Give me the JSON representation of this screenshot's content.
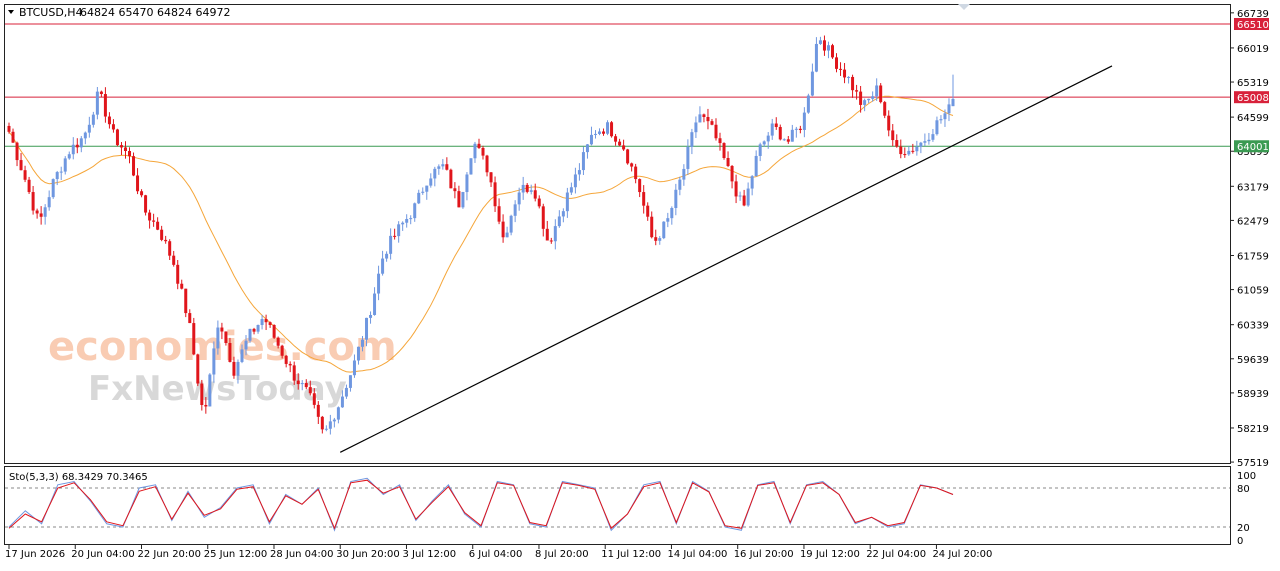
{
  "header": {
    "symbol": "BTCUSD,H4",
    "ohlc": "64824 65470 64824 64972"
  },
  "watermark": {
    "line1": "economies.com",
    "line2": "FxNewsToday"
  },
  "stochastic_label": "Sto(5,3,3) 68.3429 70.3465",
  "colors": {
    "bull": "#6f97e0",
    "bear": "#e0151b",
    "ma": "#f5a63a",
    "resistance": "#d8213a",
    "support": "#3a9a52",
    "trendline": "#000000",
    "sto_main": "#6f97e0",
    "sto_signal": "#e0151b",
    "label_red_bg": "#d8213a",
    "label_green_bg": "#3a9a52"
  },
  "chart_data": [
    {
      "type": "candlestick",
      "title": "BTCUSD,H4",
      "x_tick_labels": [
        "17 Jun 2026",
        "20 Jun 04:00",
        "22 Jun 20:00",
        "25 Jun 12:00",
        "28 Jun 04:00",
        "30 Jun 20:00",
        "3 Jul 12:00",
        "6 Jul 04:00",
        "8 Jul 20:00",
        "11 Jul 12:00",
        "14 Jul 04:00",
        "16 Jul 20:00",
        "19 Jul 12:00",
        "22 Jul 04:00",
        "24 Jul 20:00"
      ],
      "y_tick_labels": [
        66739,
        66019,
        65319,
        64599,
        63899,
        63179,
        62479,
        61759,
        61059,
        60339,
        59639,
        58939,
        58219,
        57519
      ],
      "ylim": [
        57500,
        66900
      ],
      "current_bar": {
        "open": 64824,
        "high": 65470,
        "low": 64824,
        "close": 64972
      },
      "horizontal_levels": [
        {
          "value": 66510,
          "label": "66510",
          "role": "resistance"
        },
        {
          "value": 65008,
          "label": "65008",
          "role": "resistance"
        },
        {
          "value": 64001,
          "label": "64001",
          "role": "support"
        }
      ],
      "trendline": {
        "from": {
          "x": "30 Jun 20:00",
          "y": 57720
        },
        "to": {
          "x": "27 Jul",
          "y": 65650
        }
      },
      "price_path": [
        64300,
        63400,
        62400,
        63300,
        63900,
        64200,
        65100,
        64200,
        63800,
        62700,
        62300,
        61600,
        60400,
        58400,
        60500,
        59400,
        60100,
        60500,
        59900,
        59300,
        58900,
        58050,
        58700,
        59500,
        60500,
        61800,
        62300,
        62700,
        63400,
        63600,
        62800,
        64100,
        63500,
        62100,
        63100,
        63200,
        62000,
        62800,
        63500,
        64300,
        64400,
        64000,
        63200,
        62000,
        62500,
        63500,
        64700,
        64300,
        63500,
        62700,
        63900,
        64400,
        64100,
        64500,
        66300,
        65800,
        65400,
        64800,
        65200,
        64000,
        63900,
        64100,
        64500,
        64850
      ]
    },
    {
      "type": "line",
      "title": "Sto(5,3,3) 68.3429 70.3465",
      "y_tick_labels": [
        100,
        80,
        20,
        0
      ],
      "ylim": [
        0,
        100
      ],
      "levels": [
        80,
        20
      ],
      "series": [
        {
          "values": [
            20,
            45,
            25,
            85,
            90,
            60,
            25,
            20,
            80,
            85,
            30,
            75,
            35,
            50,
            80,
            85,
            25,
            70,
            55,
            80,
            15,
            90,
            95,
            70,
            85,
            30,
            60,
            85,
            40,
            20,
            90,
            85,
            25,
            20,
            90,
            85,
            80,
            15,
            40,
            85,
            90,
            25,
            90,
            75,
            20,
            15,
            85,
            90,
            25,
            85,
            90,
            70,
            25,
            35,
            20,
            25,
            85,
            80,
            70
          ]
        },
        {
          "values": [
            18,
            40,
            28,
            80,
            88,
            62,
            28,
            22,
            75,
            82,
            32,
            72,
            38,
            48,
            78,
            82,
            28,
            68,
            55,
            78,
            18,
            88,
            92,
            72,
            82,
            32,
            58,
            82,
            42,
            22,
            88,
            84,
            27,
            22,
            88,
            84,
            78,
            18,
            40,
            82,
            88,
            27,
            88,
            74,
            22,
            18,
            84,
            88,
            27,
            84,
            88,
            70,
            27,
            35,
            22,
            27,
            84,
            80,
            70
          ]
        }
      ]
    }
  ]
}
